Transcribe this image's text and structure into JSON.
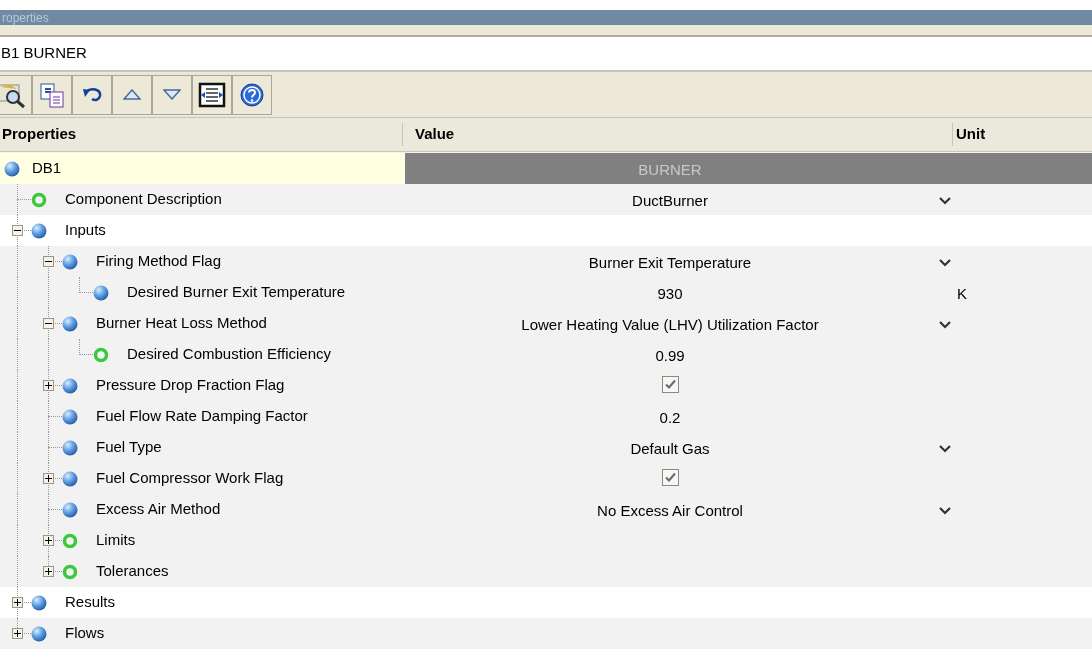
{
  "window": {
    "title": "roperties"
  },
  "object_name": "B1 BURNER",
  "columns": [
    "Properties",
    "Value",
    "Unit"
  ],
  "tree": [
    {
      "label": "DB1",
      "hollow": false,
      "kind": "header",
      "value": "BURNER",
      "children": [
        {
          "label": "Component Description",
          "hollow": true,
          "kind": "dropdown",
          "value": "DuctBurner"
        },
        {
          "label": "Inputs",
          "hollow": false,
          "kind": "category",
          "expanded": true,
          "children": [
            {
              "label": "Firing Method Flag",
              "hollow": false,
              "kind": "dropdown",
              "value": "Burner Exit Temperature",
              "expanded": true,
              "children": [
                {
                  "label": "Desired Burner Exit Temperature",
                  "hollow": false,
                  "kind": "text",
                  "value": "930",
                  "unit": "K"
                }
              ]
            },
            {
              "label": "Burner Heat Loss Method",
              "hollow": false,
              "kind": "dropdown",
              "value": "Lower Heating Value (LHV) Utilization Factor",
              "expanded": true,
              "children": [
                {
                  "label": "Desired Combustion Efficiency",
                  "hollow": true,
                  "kind": "text",
                  "value": "0.99"
                }
              ]
            },
            {
              "label": "Pressure Drop Fraction Flag",
              "hollow": false,
              "kind": "checkbox",
              "checked": true,
              "expanded": false
            },
            {
              "label": "Fuel Flow Rate Damping Factor",
              "hollow": false,
              "kind": "text",
              "value": "0.2"
            },
            {
              "label": "Fuel Type",
              "hollow": false,
              "kind": "dropdown",
              "value": "Default Gas"
            },
            {
              "label": "Fuel Compressor Work Flag",
              "hollow": false,
              "kind": "checkbox",
              "checked": true,
              "expanded": false
            },
            {
              "label": "Excess Air Method",
              "hollow": false,
              "kind": "dropdown",
              "value": "No Excess Air Control"
            },
            {
              "label": "Limits",
              "hollow": true,
              "kind": "group",
              "expanded": false
            },
            {
              "label": "Tolerances",
              "hollow": true,
              "kind": "group",
              "expanded": false
            }
          ]
        },
        {
          "label": "Results",
          "hollow": false,
          "kind": "category",
          "expanded": false
        },
        {
          "label": "Flows",
          "hollow": false,
          "kind": "group",
          "expanded": false
        }
      ]
    }
  ]
}
